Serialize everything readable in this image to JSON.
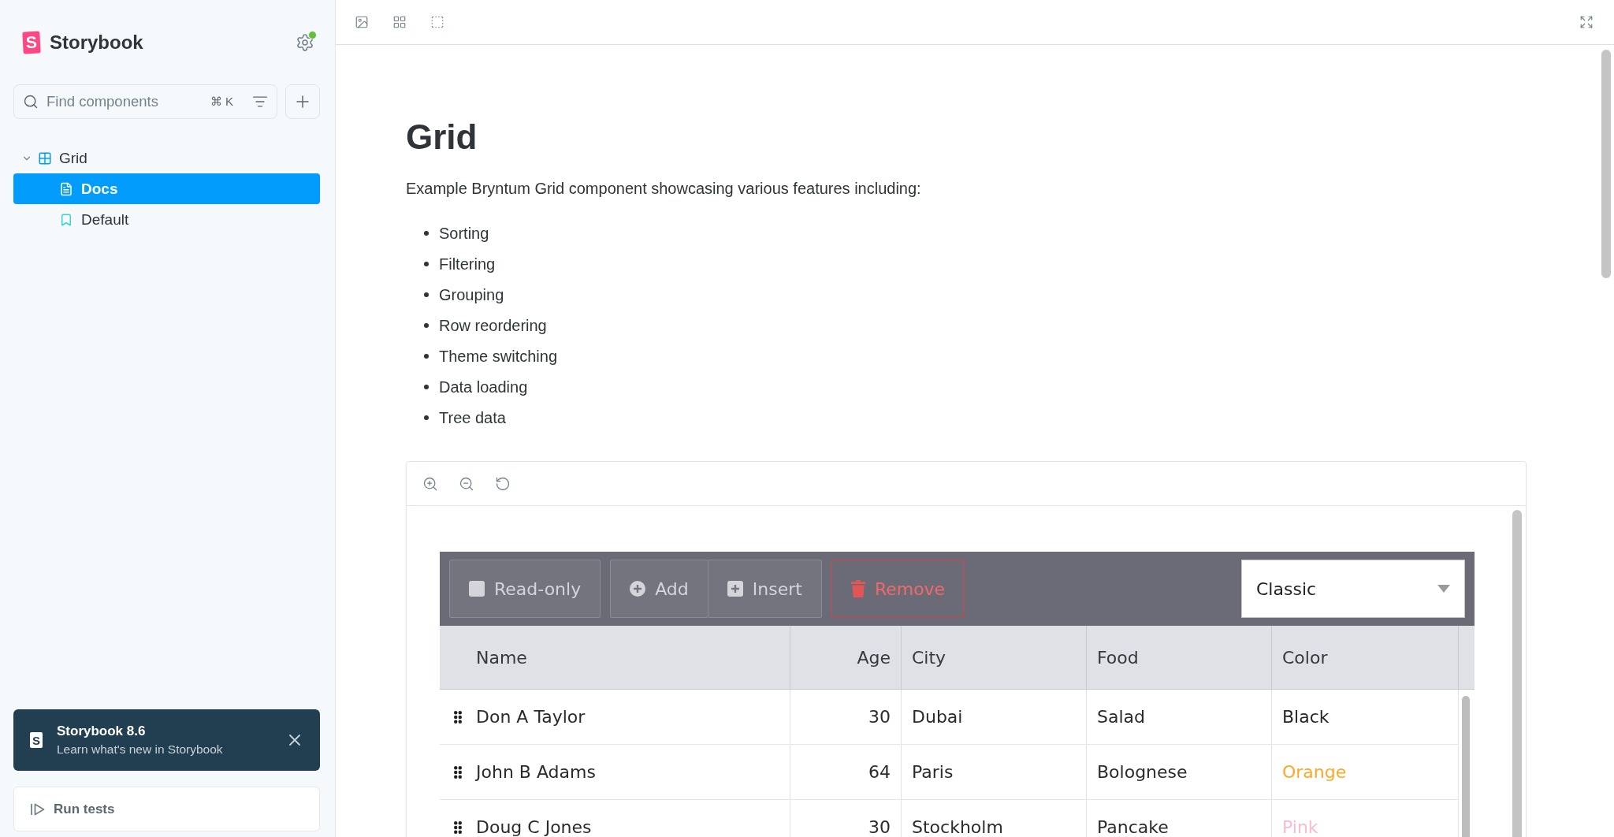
{
  "sidebar": {
    "brand": {
      "mark": "S",
      "name": "Storybook"
    },
    "search": {
      "placeholder": "Find components",
      "shortcut": "⌘ K"
    },
    "tree": [
      {
        "label": "Grid",
        "kind": "component",
        "expanded": true,
        "selected": false,
        "children": [
          {
            "label": "Docs",
            "kind": "docs",
            "selected": true
          },
          {
            "label": "Default",
            "kind": "story",
            "selected": false
          }
        ]
      }
    ],
    "notification": {
      "mark": "S",
      "title": "Storybook 8.6",
      "text": "Learn what's new in Storybook"
    },
    "run_tests": {
      "label": "Run tests"
    }
  },
  "doc": {
    "title": "Grid",
    "description": "Example Bryntum Grid component showcasing various features including:",
    "features": [
      "Sorting",
      "Filtering",
      "Grouping",
      "Row reordering",
      "Theme switching",
      "Data loading",
      "Tree data"
    ]
  },
  "grid": {
    "toolbar": [
      [
        {
          "label": "Read-only",
          "kind": "toggle",
          "checked": false
        }
      ],
      [
        {
          "label": "Add",
          "kind": "add"
        },
        {
          "label": "Insert",
          "kind": "insert"
        }
      ],
      [
        {
          "label": "Remove",
          "kind": "remove"
        }
      ]
    ],
    "theme_select": {
      "value": "Classic"
    },
    "columns": [
      {
        "label": "Name",
        "kind": "text"
      },
      {
        "label": "Age",
        "kind": "number"
      },
      {
        "label": "City",
        "kind": "text"
      },
      {
        "label": "Food",
        "kind": "text"
      },
      {
        "label": "Color",
        "kind": "text"
      }
    ],
    "rows": [
      {
        "name": "Don A Taylor",
        "age": "30",
        "city": "Dubai",
        "food": "Salad",
        "color": {
          "label": "Black",
          "color": "#262626"
        }
      },
      {
        "name": "John B Adams",
        "age": "64",
        "city": "Paris",
        "food": "Bolognese",
        "color": {
          "label": "Orange",
          "color": "#ffa726"
        }
      },
      {
        "name": "Doug C Jones",
        "age": "30",
        "city": "Stockholm",
        "food": "Pancake",
        "color": {
          "label": "Pink",
          "color": "#f8bbd0"
        }
      }
    ]
  }
}
